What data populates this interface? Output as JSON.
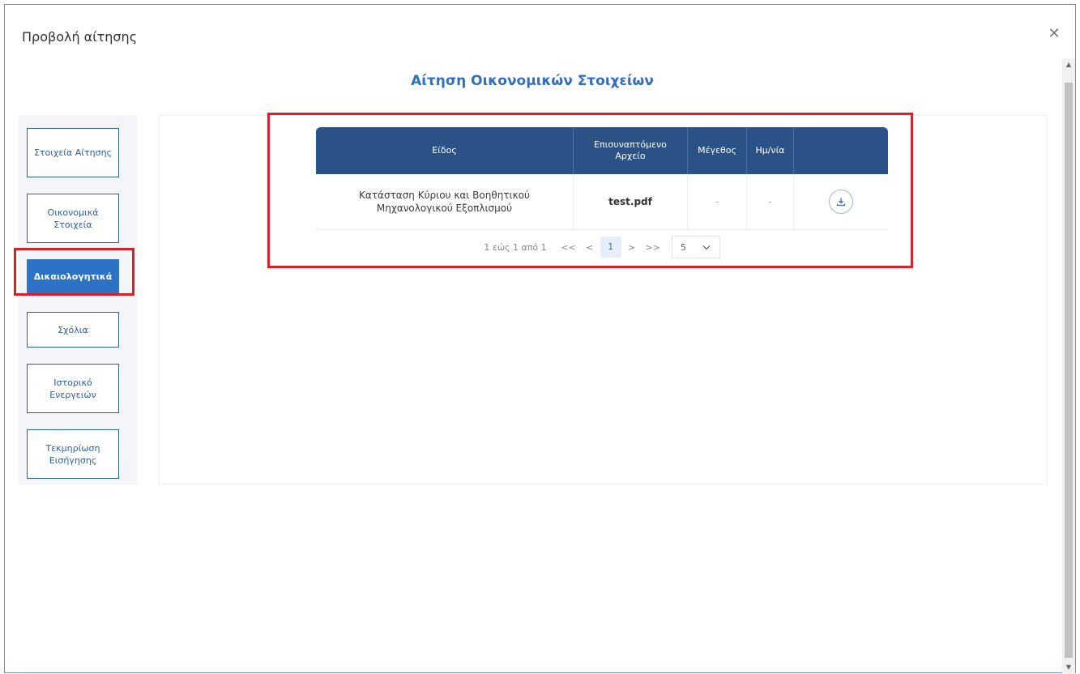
{
  "modal": {
    "title": "Προβολή αίτησης",
    "close_glyph": "✕"
  },
  "page_heading": "Αίτηση Οικονομικών Στοιχείων",
  "sidebar": {
    "items": [
      {
        "label": "Στοιχεία Αίτησης",
        "active": false
      },
      {
        "label": "Οικονομικά Στοιχεία",
        "active": false
      },
      {
        "label": "Δικαιολογητικά",
        "active": true
      },
      {
        "label": "Σχόλια",
        "active": false
      },
      {
        "label": "Ιστορικό Ενεργειών",
        "active": false
      },
      {
        "label": "Τεκμηρίωση Εισήγησης",
        "active": false
      }
    ]
  },
  "table": {
    "headers": [
      "Είδος",
      "Επισυναπτόμενο Αρχείο",
      "Μέγεθος",
      "Ημ/νία",
      ""
    ],
    "rows": [
      {
        "type": "Κατάσταση Κύριου και Βοηθητικού Μηχανολογικού Εξοπλισμού",
        "file": "test.pdf",
        "size": "-",
        "date": "-",
        "action_icon": "download-icon"
      }
    ]
  },
  "pagination": {
    "info": "1 εώς 1 από 1",
    "first": "<<",
    "prev": "<",
    "current_page": "1",
    "next": ">",
    "last": ">>",
    "page_size": "5"
  },
  "colors": {
    "accent": "#2c72c7",
    "header_bg": "#2a5286",
    "heading": "#2f6ec0",
    "highlight": "#d8202b"
  }
}
